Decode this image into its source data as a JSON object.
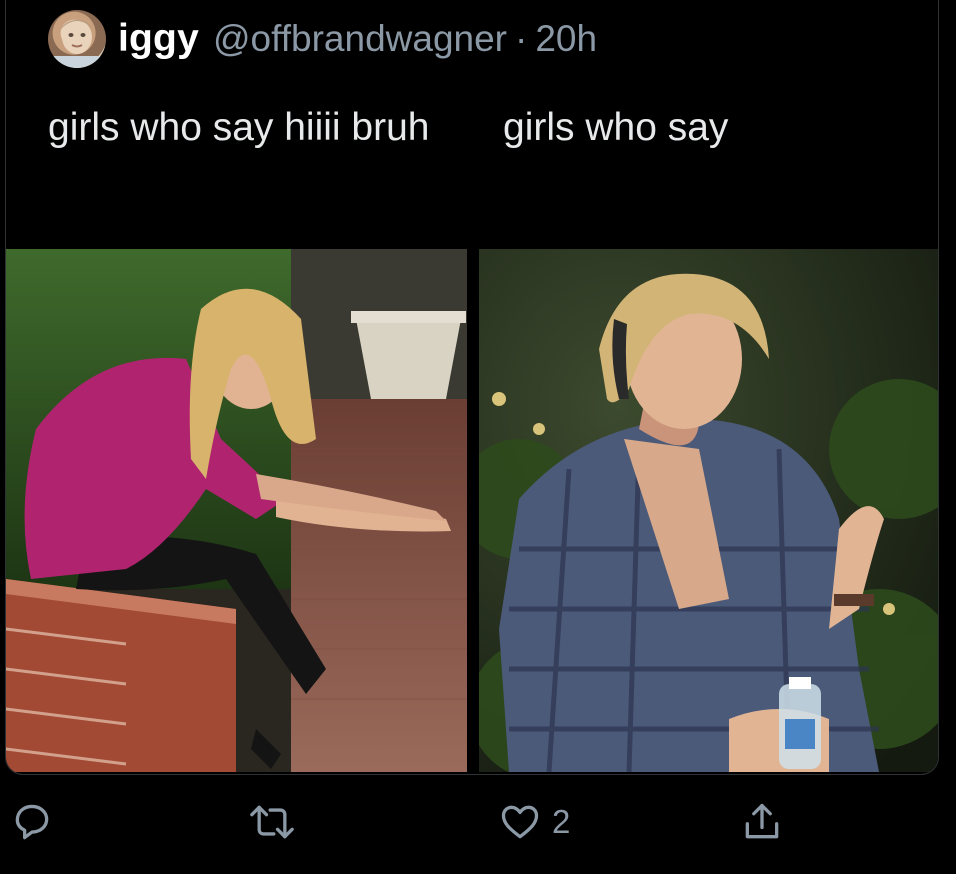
{
  "tweet": {
    "name": "iggy",
    "handle": "@offbrandwagner",
    "separator": "·",
    "time": "20h",
    "left_caption": "girls who say hiiii bruh",
    "right_caption": "girls who say"
  },
  "actions": {
    "reply_icon": "reply-icon",
    "retweet_icon": "retweet-icon",
    "like_icon": "heart-icon",
    "like_count": "2",
    "share_icon": "share-icon"
  },
  "colors": {
    "background": "#000000",
    "text": "#e7e9ea",
    "muted": "#8b98a5",
    "border": "#2f3336"
  }
}
